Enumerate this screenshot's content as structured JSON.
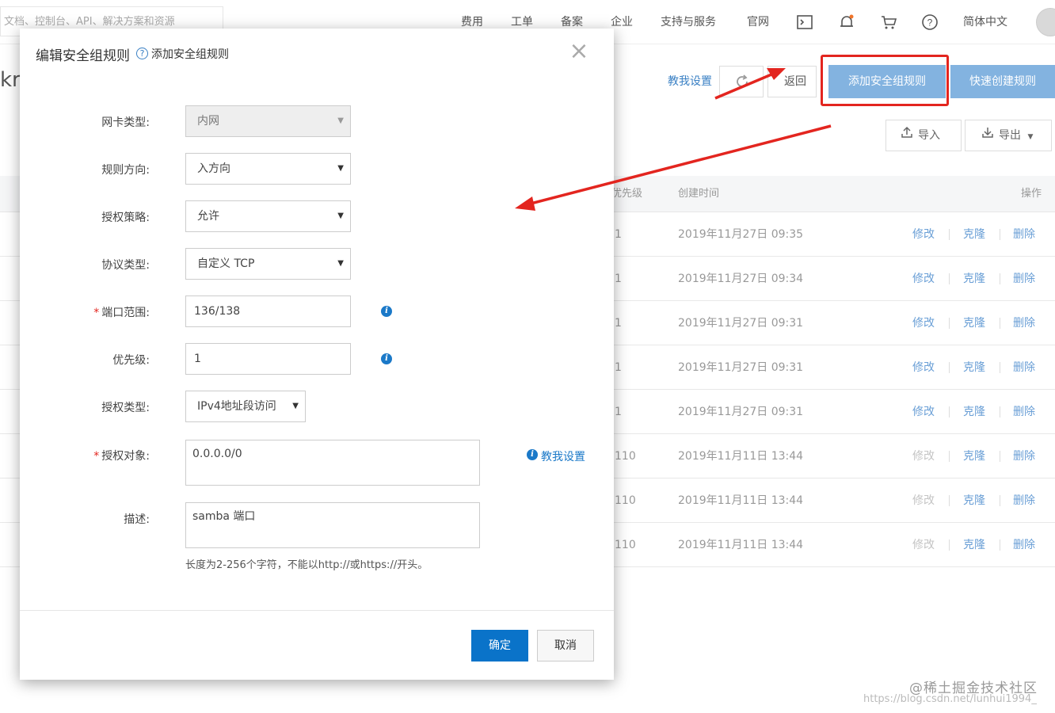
{
  "topbar": {
    "search_placeholder": "文档、控制台、API、解决方案和资源",
    "nav": [
      "费用",
      "工单",
      "备案",
      "企业",
      "支持与服务",
      "官网"
    ],
    "language": "简体中文",
    "icons": [
      "terminal-icon",
      "bell-icon",
      "cart-icon",
      "help-icon"
    ]
  },
  "page": {
    "title_fragment": "kr",
    "teach_link": "教我设置",
    "back_label": "返回",
    "add_rule_label": "添加安全组规则",
    "quick_rule_label": "快速创建规则",
    "import_label": "导入",
    "export_label": "导出"
  },
  "table": {
    "headers": {
      "priority": "优先级",
      "created": "创建时间",
      "actions": "操作"
    },
    "rows": [
      {
        "priority": "1",
        "created": "2019年11月27日 09:35",
        "edit": "修改",
        "clone": "克隆",
        "delete": "删除"
      },
      {
        "priority": "1",
        "created": "2019年11月27日 09:34",
        "edit": "修改",
        "clone": "克隆",
        "delete": "删除"
      },
      {
        "priority": "1",
        "created": "2019年11月27日 09:31",
        "edit": "修改",
        "clone": "克隆",
        "delete": "删除"
      },
      {
        "priority": "1",
        "created": "2019年11月27日 09:31",
        "edit": "修改",
        "clone": "克隆",
        "delete": "删除"
      },
      {
        "priority": "1",
        "created": "2019年11月27日 09:31",
        "edit": "修改",
        "clone": "克隆",
        "delete": "删除"
      },
      {
        "priority": "110",
        "created": "2019年11月11日 13:44",
        "edit": "修改",
        "clone": "克隆",
        "delete": "删除"
      },
      {
        "priority": "110",
        "created": "2019年11月11日 13:44",
        "edit": "修改",
        "clone": "克隆",
        "delete": "删除"
      },
      {
        "priority": "110",
        "created": "2019年11月11日 13:44",
        "edit": "修改",
        "clone": "克隆",
        "delete": "删除"
      }
    ]
  },
  "modal": {
    "title": "编辑安全组规则",
    "subtitle": "添加安全组规则",
    "fields": {
      "nic_type": {
        "label": "网卡类型:",
        "value": "内网"
      },
      "direction": {
        "label": "规则方向:",
        "value": "入方向"
      },
      "policy": {
        "label": "授权策略:",
        "value": "允许"
      },
      "protocol": {
        "label": "协议类型:",
        "value": "自定义 TCP"
      },
      "port_range": {
        "label": "端口范围:",
        "value": "136/138"
      },
      "priority": {
        "label": "优先级:",
        "value": "1"
      },
      "auth_type": {
        "label": "授权类型:",
        "value": "IPv4地址段访问"
      },
      "auth_object": {
        "label": "授权对象:",
        "value": "0.0.0.0/0"
      },
      "description": {
        "label": "描述:",
        "value": "samba 端口"
      }
    },
    "required_mark": "*",
    "teach_link": "教我设置",
    "hint": "长度为2-256个字符，不能以http://或https://开头。",
    "ok_label": "确定",
    "cancel_label": "取消"
  },
  "watermark": {
    "line1": "@稀土掘金技术社区",
    "line2": "https://blog.csdn.net/lunhui1994_"
  },
  "colors": {
    "primary": "#0a73c9",
    "link": "#3a80c4",
    "annotation": "#e3251f",
    "disabled_button": "#83b3e0"
  }
}
